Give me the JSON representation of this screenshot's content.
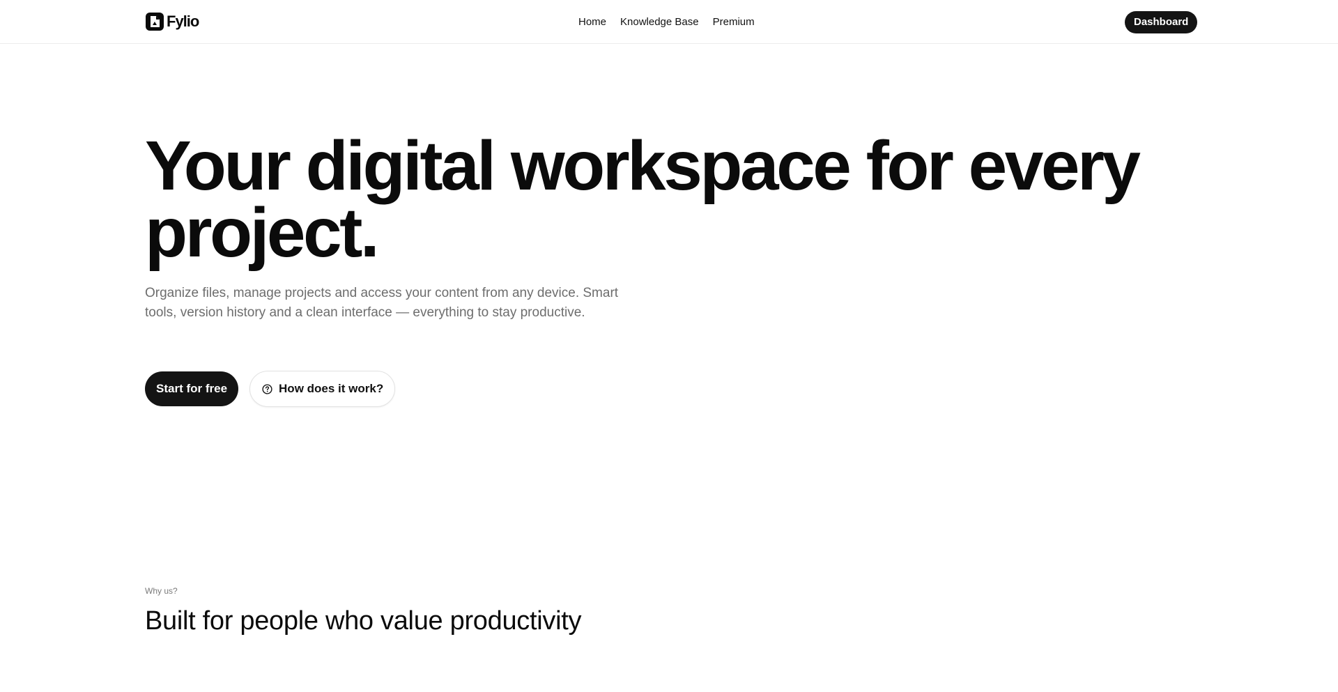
{
  "header": {
    "brand_name": "Fylio",
    "logo_icon": "document-logo-icon",
    "nav": [
      {
        "label": "Home"
      },
      {
        "label": "Knowledge Base"
      },
      {
        "label": "Premium"
      }
    ],
    "dashboard_label": "Dashboard"
  },
  "hero": {
    "title": "Your digital workspace for every project.",
    "subtitle": "Organize files, manage projects and access your content from any device. Smart tools, version history and a clean interface — everything to stay productive.",
    "primary_cta": "Start for free",
    "secondary_cta": "How does it work?",
    "secondary_icon": "question-circle-icon"
  },
  "why": {
    "eyebrow": "Why us?",
    "title": "Built for people who value productivity"
  },
  "colors": {
    "primary": "#141414",
    "muted_text": "#6d6d6d",
    "border": "#e2e2e2"
  }
}
